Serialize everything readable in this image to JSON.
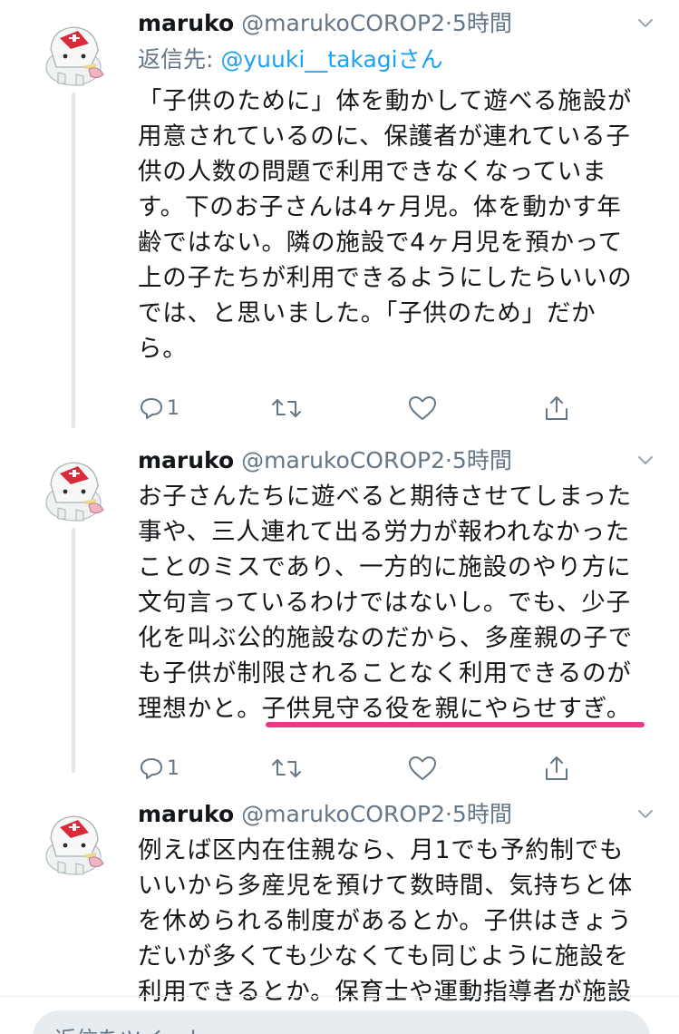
{
  "colors": {
    "link": "#1da1f2",
    "secondary_text": "#657786",
    "underline_marker": "#e63b84"
  },
  "tweets": [
    {
      "name": "maruko",
      "handle": "@marukoCOROP2",
      "time": "·5時間",
      "reply_prefix": "返信先: ",
      "reply_mention": "@yuuki__takagiさん",
      "body": "「子供のために」体を動かして遊べる施設が\n用意されているのに、保護者が連れている子\n供の人数の問題で利用できなくなっていま\nす。下のお子さんは4ヶ月児。体を動かす年\n齢ではない。隣の施設で4ヶ月児を預かって\n上の子たちが利用できるようにしたらいいの\nでは、と思いました。「子供のため」だか\nら。",
      "reply_count": "1",
      "icons": [
        "avatar",
        "chevron-down-icon",
        "reply-icon",
        "retweet-icon",
        "like-icon",
        "share-icon"
      ]
    },
    {
      "name": "maruko",
      "handle": "@marukoCOROP2",
      "time": "·5時間",
      "body_main": "お子さんたちに遊べると期待させてしまった\n事や、三人連れて出る労力が報われなかった\nことのミスであり、一方的に施設のやり方に\n文句言っているわけではないし。でも、少子\n化を叫ぶ公的施設なのだから、多産親の子で\nも子供が制限されることなく利用できるのが\n理想かと。",
      "body_highlight": "子供見守る役を親にやらせすぎ。",
      "reply_count": "1"
    },
    {
      "name": "maruko",
      "handle": "@marukoCOROP2",
      "time": "·5時間",
      "body": "例えば区内在住親なら、月1でも予約制でも\nいいから多産児を預けて数時間、気持ちと体\nを休められる制度があるとか。子供はきょう\nだいが多くても少なくても同じように施設を\n利用できるとか。保育士や運動指導者が施設"
    }
  ],
  "reply_box": {
    "placeholder": "返信をツイート"
  }
}
